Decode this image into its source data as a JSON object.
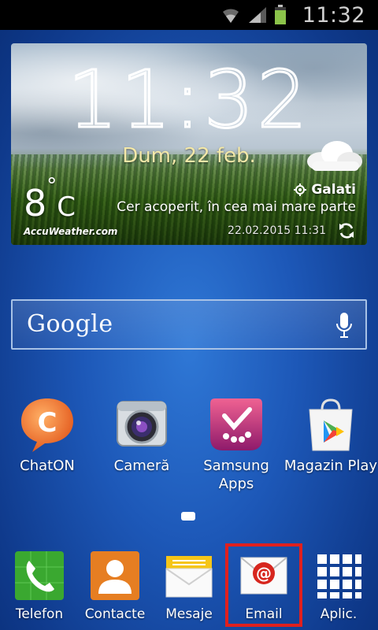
{
  "status_bar": {
    "time": "11:32",
    "icons": [
      "wifi-icon",
      "signal-icon",
      "battery-icon"
    ],
    "battery_color": "#8bc34a"
  },
  "weather": {
    "time": "11:32",
    "date": "Dum, 22 feb.",
    "temperature": "8",
    "degree": "°",
    "unit": "C",
    "location": "Galati",
    "condition": "Cer acoperit, în cea mai mare parte",
    "brand": "AccuWeather.com",
    "updated": "22.02.2015 11:31"
  },
  "search": {
    "logo": "Google"
  },
  "apps": [
    {
      "label": "ChatON",
      "icon": "chaton-icon",
      "color": "#f26b1d"
    },
    {
      "label": "Cameră",
      "icon": "camera-icon",
      "color": "#9ca4ac"
    },
    {
      "label": "Samsung Apps",
      "icon": "samsung-apps-icon",
      "color": "#c2185b"
    },
    {
      "label": "Magazin Play",
      "icon": "play-store-icon",
      "color": "#ffffff"
    }
  ],
  "dock": [
    {
      "label": "Telefon",
      "icon": "phone-icon",
      "color": "#3aa830"
    },
    {
      "label": "Contacte",
      "icon": "contacts-icon",
      "color": "#e67e22"
    },
    {
      "label": "Mesaje",
      "icon": "messages-icon",
      "color": "#f5c518"
    },
    {
      "label": "Email",
      "icon": "email-icon",
      "color": "#e0201e"
    },
    {
      "label": "Aplic.",
      "icon": "apps-grid-icon",
      "color": "#ffffff"
    }
  ],
  "highlight_color": "#e0201e"
}
